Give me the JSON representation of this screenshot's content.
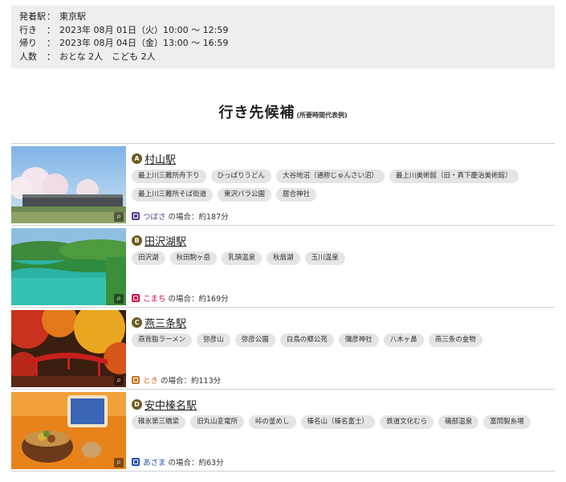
{
  "summary": {
    "rows": [
      {
        "label": "発着駅",
        "sep": "：",
        "value": "東京駅"
      },
      {
        "label": "行き",
        "sep": "：",
        "value": "2023年 08月 01日（火）10:00 ～ 12:59"
      },
      {
        "label": "帰り",
        "sep": "：",
        "value": "2023年 08月 04日（金）13:00 ～ 16:59"
      },
      {
        "label": "人数",
        "sep": "：",
        "value": "おとな 2人　こども 2人"
      }
    ]
  },
  "heading": {
    "title": "行き先候補",
    "subtitle": "(所要時間代表例)"
  },
  "destinations": [
    {
      "badge": "A",
      "station": "村山駅",
      "tags": [
        "最上川三難所舟下り",
        "ひっぱりうどん",
        "大谷地沼（通称じゅんさい沼）",
        "最上川美術館（旧・真下慶治美術館）",
        "最上川三難所そば街道",
        "東沢バラ公園",
        "居合神社"
      ],
      "train": {
        "name": "つばさ",
        "suffix": "の場合：約187分",
        "color": "#5a3e8c"
      }
    },
    {
      "badge": "B",
      "station": "田沢湖駅",
      "tags": [
        "田沢湖",
        "秋田駒ヶ岳",
        "乳頭温泉",
        "秋扇湖",
        "玉川温泉"
      ],
      "train": {
        "name": "こまち",
        "suffix": "の場合：約169分",
        "color": "#d0104c"
      }
    },
    {
      "badge": "C",
      "station": "燕三条駅",
      "tags": [
        "燕背脂ラーメン",
        "弥彦山",
        "弥彦公園",
        "白鳥の郷公苑",
        "彌彦神社",
        "八木ヶ鼻",
        "燕三条の金物"
      ],
      "train": {
        "name": "とき",
        "suffix": "の場合：約113分",
        "color": "#c9782a"
      }
    },
    {
      "badge": "D",
      "station": "安中榛名駅",
      "tags": [
        "碓氷第三橋梁",
        "旧丸山変電所",
        "峠の釜めし",
        "榛名山（榛名富士）",
        "鉄道文化むら",
        "磯部温泉",
        "富岡製糸場"
      ],
      "train": {
        "name": "あさま",
        "suffix": "の場合：約63分",
        "color": "#1e4fa8"
      }
    }
  ]
}
